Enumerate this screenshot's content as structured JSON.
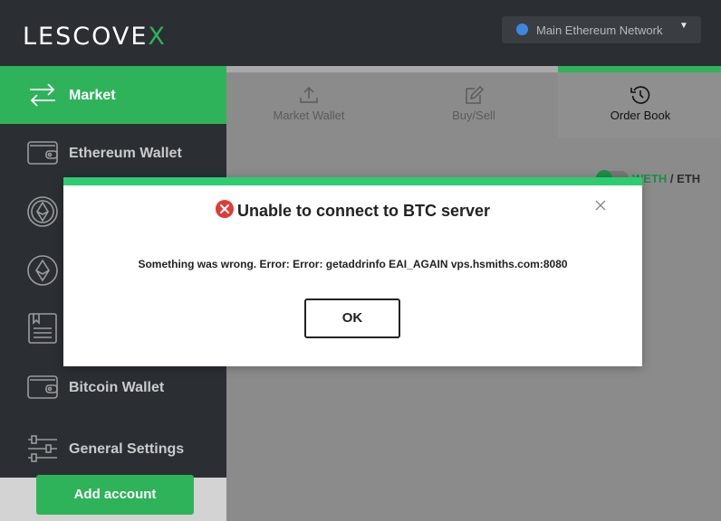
{
  "app": {
    "logo_text": "LESCOVE",
    "logo_accent": "X",
    "accent_color": "#2eb35a"
  },
  "header": {
    "network_label": "Main Ethereum Network",
    "network_status_color": "#3c88e0"
  },
  "sidebar": {
    "items": [
      {
        "label": "Market",
        "icon": "market-arrows-icon",
        "active": true
      },
      {
        "label": "Ethereum Wallet",
        "icon": "wallet-icon"
      },
      {
        "label": "",
        "icon": "token-coin-icon"
      },
      {
        "label": "",
        "icon": "ethereum-icon"
      },
      {
        "label": "",
        "icon": "ledger-book-icon"
      },
      {
        "label": "Bitcoin Wallet",
        "icon": "wallet-icon"
      },
      {
        "label": "General Settings",
        "icon": "sliders-icon"
      }
    ],
    "add_account_label": "Add account"
  },
  "main": {
    "tabs": [
      {
        "label": "Market Wallet",
        "icon": "upload-icon"
      },
      {
        "label": "Buy/Sell",
        "icon": "edit-icon"
      },
      {
        "label": "Order Book",
        "icon": "history-icon",
        "active": true
      }
    ],
    "pair_base": "WETH",
    "pair_separator": "/",
    "pair_quote": "ETH"
  },
  "modal": {
    "title": "Unable to connect to BTC server",
    "message": "Something was wrong. Error: Error: getaddrinfo EAI_AGAIN vps.hsmiths.com:8080",
    "ok_label": "OK",
    "status_color": "#e53935"
  }
}
